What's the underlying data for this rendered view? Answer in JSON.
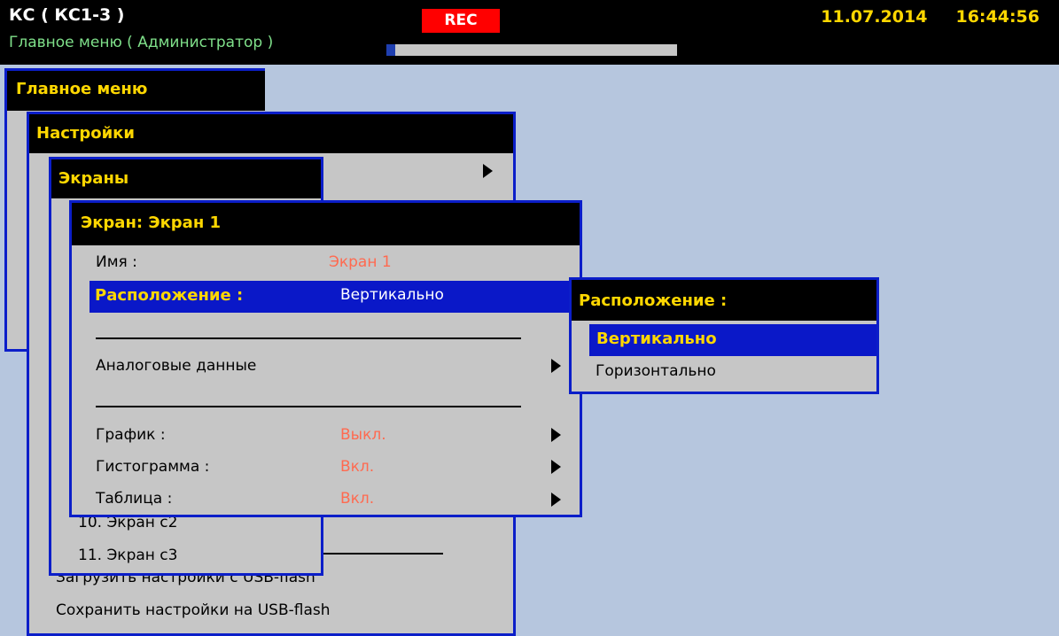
{
  "header": {
    "title": "КС ( КС1-3 )",
    "subtitle": "Главное меню ( Администратор )",
    "rec_label": "REC",
    "date": "11.07.2014",
    "time": "16:44:56",
    "progress_fraction": 0.03
  },
  "main_menu": {
    "title": "Главное меню"
  },
  "settings_menu": {
    "title": "Настройки",
    "items": [
      "Загрузить настройки с USB-flash",
      "Сохранить настройки на USB-flash"
    ]
  },
  "screens_menu": {
    "title": "Экраны",
    "items": [
      "10. Экран с2",
      "11. Экран с3"
    ]
  },
  "screen_editor": {
    "title": "Экран: Экран 1",
    "name_label": "Имя :",
    "name_value": "Экран 1",
    "layout_label": "Расположение :",
    "layout_value": "Вертикально",
    "analog_label": "Аналоговые данные",
    "graph_label": "График :",
    "graph_value": "Выкл.",
    "histogram_label": "Гистограмма :",
    "histogram_value": "Вкл.",
    "table_label": "Таблица :",
    "table_value": "Вкл."
  },
  "layout_popup": {
    "title": "Расположение :",
    "options": [
      "Вертикально",
      "Горизонтально"
    ],
    "selected": "Вертикально"
  },
  "colors": {
    "frame": "#0b1ec9",
    "accent": "#ffd700",
    "value_red": "#ff6a50",
    "background": "#b6c6de"
  }
}
